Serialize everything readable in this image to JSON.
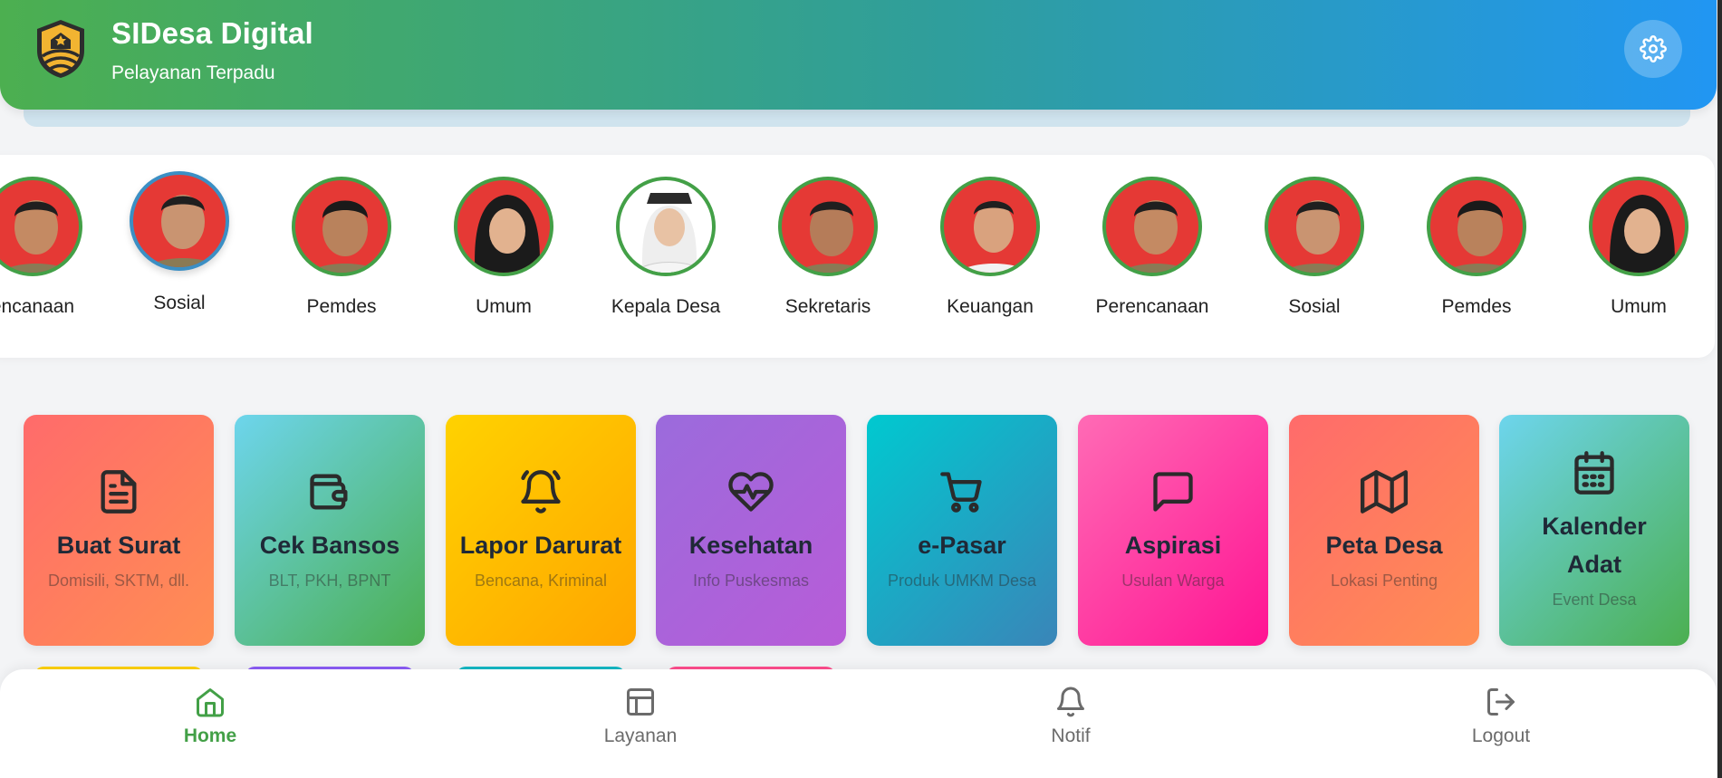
{
  "header": {
    "title": "SIDesa Digital",
    "subtitle": "Pelayanan Terpadu",
    "settings_icon": "gear-icon",
    "logo_icon": "village-shield-logo"
  },
  "staff": [
    {
      "label": "encanaan",
      "active": false
    },
    {
      "label": "Sosial",
      "active": true
    },
    {
      "label": "Pemdes",
      "active": false
    },
    {
      "label": "Umum",
      "active": false
    },
    {
      "label": "Kepala Desa",
      "active": false
    },
    {
      "label": "Sekretaris",
      "active": false
    },
    {
      "label": "Keuangan",
      "active": false
    },
    {
      "label": "Perencanaan",
      "active": false
    },
    {
      "label": "Sosial",
      "active": false
    },
    {
      "label": "Pemdes",
      "active": false
    },
    {
      "label": "Umum",
      "active": false
    }
  ],
  "services": [
    {
      "title": "Buat Surat",
      "subtitle": "Domisili, SKTM, dll.",
      "icon": "document-icon",
      "color_from": "#ff6b6b",
      "color_to": "#ff8e53"
    },
    {
      "title": "Cek Bansos",
      "subtitle": "BLT, PKH, BPNT",
      "icon": "wallet-icon",
      "color_from": "#6dd5ed",
      "color_to": "#4caf50"
    },
    {
      "title": "Lapor Darurat",
      "subtitle": "Bencana, Kriminal",
      "icon": "bell-icon",
      "color_from": "#ffd200",
      "color_to": "#ffa500"
    },
    {
      "title": "Kesehatan",
      "subtitle": "Info Puskesmas",
      "icon": "heart-pulse-icon",
      "color_from": "#9b6bdc",
      "color_to": "#b85cd8"
    },
    {
      "title": "e-Pasar",
      "subtitle": "Produk UMKM Desa",
      "icon": "cart-icon",
      "color_from": "#00c9d0",
      "color_to": "#3a85b8"
    },
    {
      "title": "Aspirasi",
      "subtitle": "Usulan Warga",
      "icon": "chat-icon",
      "color_from": "#ff6bb5",
      "color_to": "#ff1493"
    },
    {
      "title": "Peta Desa",
      "subtitle": "Lokasi Penting",
      "icon": "map-icon",
      "color_from": "#ff6b6b",
      "color_to": "#ff8e53"
    },
    {
      "title": "Kalender Adat",
      "subtitle": "Event Desa",
      "icon": "calendar-icon",
      "color_from": "#6dd5ed",
      "color_to": "#4caf50"
    }
  ],
  "nav": [
    {
      "label": "Home",
      "icon": "home-icon",
      "active": true
    },
    {
      "label": "Layanan",
      "icon": "layout-icon",
      "active": false
    },
    {
      "label": "Notif",
      "icon": "bell-icon",
      "active": false
    },
    {
      "label": "Logout",
      "icon": "logout-icon",
      "active": false
    }
  ]
}
